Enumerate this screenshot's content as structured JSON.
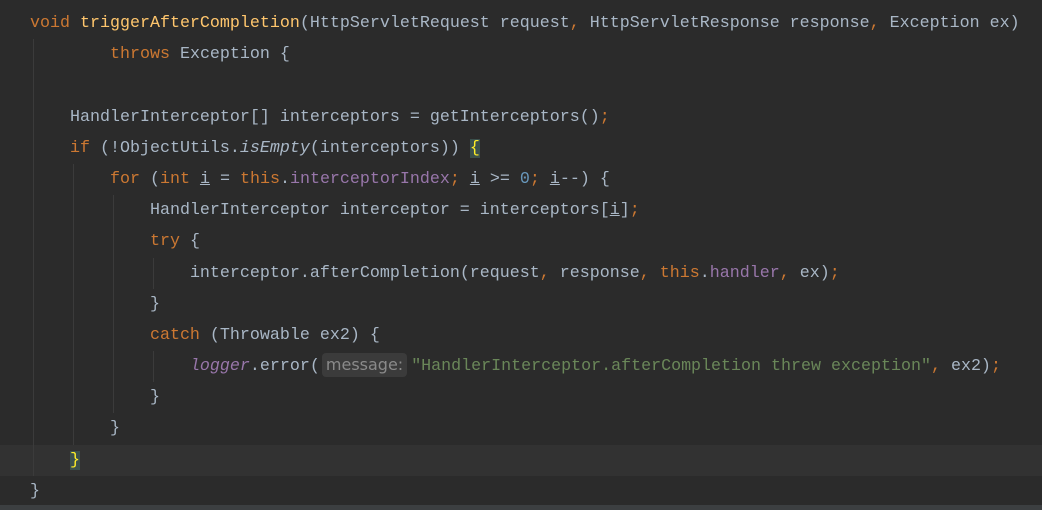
{
  "editor": {
    "language": "java",
    "colors": {
      "background": "#2b2b2b",
      "keyword": "#cc7832",
      "method": "#ffc66d",
      "text": "#a9b7c6",
      "field": "#9876aa",
      "number": "#6897bb",
      "string": "#6a8759",
      "brace_match": "#ffef28"
    },
    "current_line": 15,
    "lines": [
      {
        "indent": 0,
        "tokens": [
          [
            "void",
            "kw"
          ],
          [
            " ",
            ""
          ],
          [
            "triggerAfterCompletion",
            "fn"
          ],
          [
            "(HttpServletRequest request",
            ""
          ],
          [
            ",",
            "kw"
          ],
          [
            " HttpServletResponse response",
            ""
          ],
          [
            ",",
            "kw"
          ],
          [
            " Exception ex)",
            ""
          ]
        ]
      },
      {
        "indent": 8,
        "tokens": [
          [
            "throws",
            "kw"
          ],
          [
            " Exception {",
            ""
          ]
        ]
      },
      {
        "indent": 0,
        "tokens": []
      },
      {
        "indent": 4,
        "tokens": [
          [
            "HandlerInterceptor[] interceptors = getInterceptors()",
            ""
          ],
          [
            ";",
            "kw"
          ]
        ]
      },
      {
        "indent": 4,
        "tokens": [
          [
            "if",
            "kw"
          ],
          [
            " (!ObjectUtils.",
            ""
          ],
          [
            "isEmpty",
            "it"
          ],
          [
            "(interceptors)) ",
            ""
          ],
          [
            "{",
            "match"
          ]
        ]
      },
      {
        "indent": 8,
        "tokens": [
          [
            "for",
            "kw"
          ],
          [
            " (",
            ""
          ],
          [
            "int",
            "kw"
          ],
          [
            " ",
            ""
          ],
          [
            "i",
            "ul"
          ],
          [
            " = ",
            ""
          ],
          [
            "this",
            "kw"
          ],
          [
            ".",
            ""
          ],
          [
            "interceptorIndex",
            "field"
          ],
          [
            ";",
            "kw"
          ],
          [
            " ",
            ""
          ],
          [
            "i",
            "ul"
          ],
          [
            " >= ",
            ""
          ],
          [
            "0",
            "num"
          ],
          [
            ";",
            "kw"
          ],
          [
            " ",
            ""
          ],
          [
            "i",
            "ul"
          ],
          [
            "--) {",
            ""
          ]
        ]
      },
      {
        "indent": 12,
        "tokens": [
          [
            "HandlerInterceptor interceptor = interceptors[",
            ""
          ],
          [
            "i",
            "ul"
          ],
          [
            "]",
            ""
          ],
          [
            ";",
            "kw"
          ]
        ]
      },
      {
        "indent": 12,
        "tokens": [
          [
            "try",
            "kw"
          ],
          [
            " {",
            ""
          ]
        ]
      },
      {
        "indent": 16,
        "tokens": [
          [
            "interceptor.afterCompletion(request",
            ""
          ],
          [
            ",",
            "kw"
          ],
          [
            " response",
            ""
          ],
          [
            ",",
            "kw"
          ],
          [
            " ",
            ""
          ],
          [
            "this",
            "kw"
          ],
          [
            ".",
            ""
          ],
          [
            "handler",
            "field"
          ],
          [
            ",",
            "kw"
          ],
          [
            " ex)",
            ""
          ],
          [
            ";",
            "kw"
          ]
        ]
      },
      {
        "indent": 12,
        "tokens": [
          [
            "}",
            ""
          ]
        ]
      },
      {
        "indent": 12,
        "tokens": [
          [
            "catch",
            "kw"
          ],
          [
            " (Throwable ex2) {",
            ""
          ]
        ]
      },
      {
        "indent": 16,
        "tokens": [
          [
            "logger",
            "field it"
          ],
          [
            ".error(",
            ""
          ],
          [
            "message:",
            "hint"
          ],
          [
            "\"HandlerInterceptor.afterCompletion threw exception\"",
            "str"
          ],
          [
            ",",
            "kw"
          ],
          [
            " ex2)",
            ""
          ],
          [
            ";",
            "kw"
          ]
        ]
      },
      {
        "indent": 12,
        "tokens": [
          [
            "}",
            ""
          ]
        ]
      },
      {
        "indent": 8,
        "tokens": [
          [
            "}",
            ""
          ]
        ]
      },
      {
        "indent": 4,
        "tokens": [
          [
            "}",
            "match"
          ]
        ]
      },
      {
        "indent": 0,
        "tokens": [
          [
            "}",
            ""
          ]
        ]
      }
    ]
  }
}
